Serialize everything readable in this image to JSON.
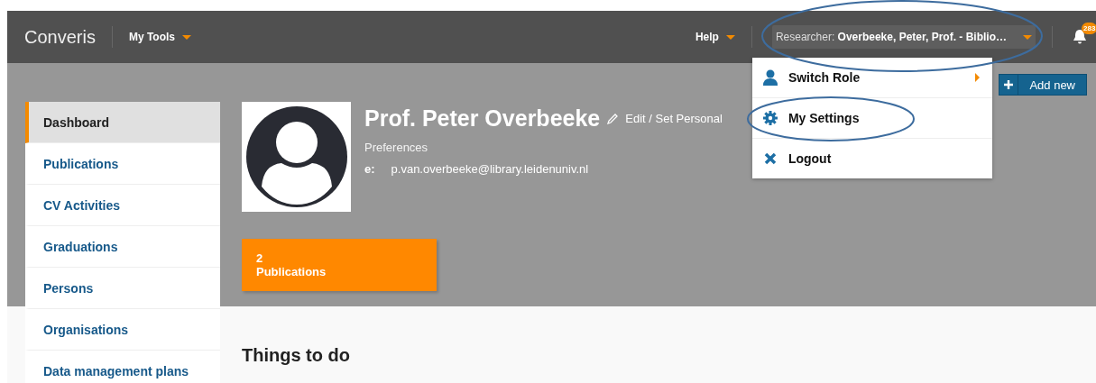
{
  "header": {
    "logo": "Converis",
    "menus": [
      {
        "label": "My Tools",
        "kind": "dropdown"
      }
    ],
    "help": {
      "label": "Help"
    },
    "account": {
      "label": "Researcher: **Overbeeke, Peter, Prof. - Biblio…**",
      "expanded": true
    },
    "notifications": {
      "count": "283"
    }
  },
  "account_menu": [
    {
      "label": "Switch Role",
      "kind": "person",
      "submenu": true
    },
    {
      "label": "My Settings",
      "kind": "gear",
      "submenu": false
    },
    {
      "label": "Logout",
      "kind": "cross",
      "submenu": false
    }
  ],
  "add_button": {
    "label": "Add new"
  },
  "sidebar": {
    "items": [
      {
        "label": "Dashboard",
        "selected": true
      },
      {
        "label": "Publications",
        "selected": false
      },
      {
        "label": "CV Activities",
        "selected": false
      },
      {
        "label": "Graduations",
        "selected": false
      },
      {
        "label": "Persons",
        "selected": false
      },
      {
        "label": "Organisations",
        "selected": false
      },
      {
        "label": "Data management plans",
        "selected": false
      }
    ]
  },
  "profile": {
    "name": "Prof. Peter Overbeeke",
    "edit_link": "Edit / Set Personal",
    "preferences": "Preferences",
    "email_label": "e:",
    "email": "p.van.overbeeke@library.leidenuniv.nl"
  },
  "tiles": [
    {
      "count": "2",
      "label": "Publications"
    }
  ],
  "section_title": "Things to do",
  "annotations": [
    {
      "kind": "ellipse"
    },
    {
      "kind": "ellipse"
    }
  ]
}
